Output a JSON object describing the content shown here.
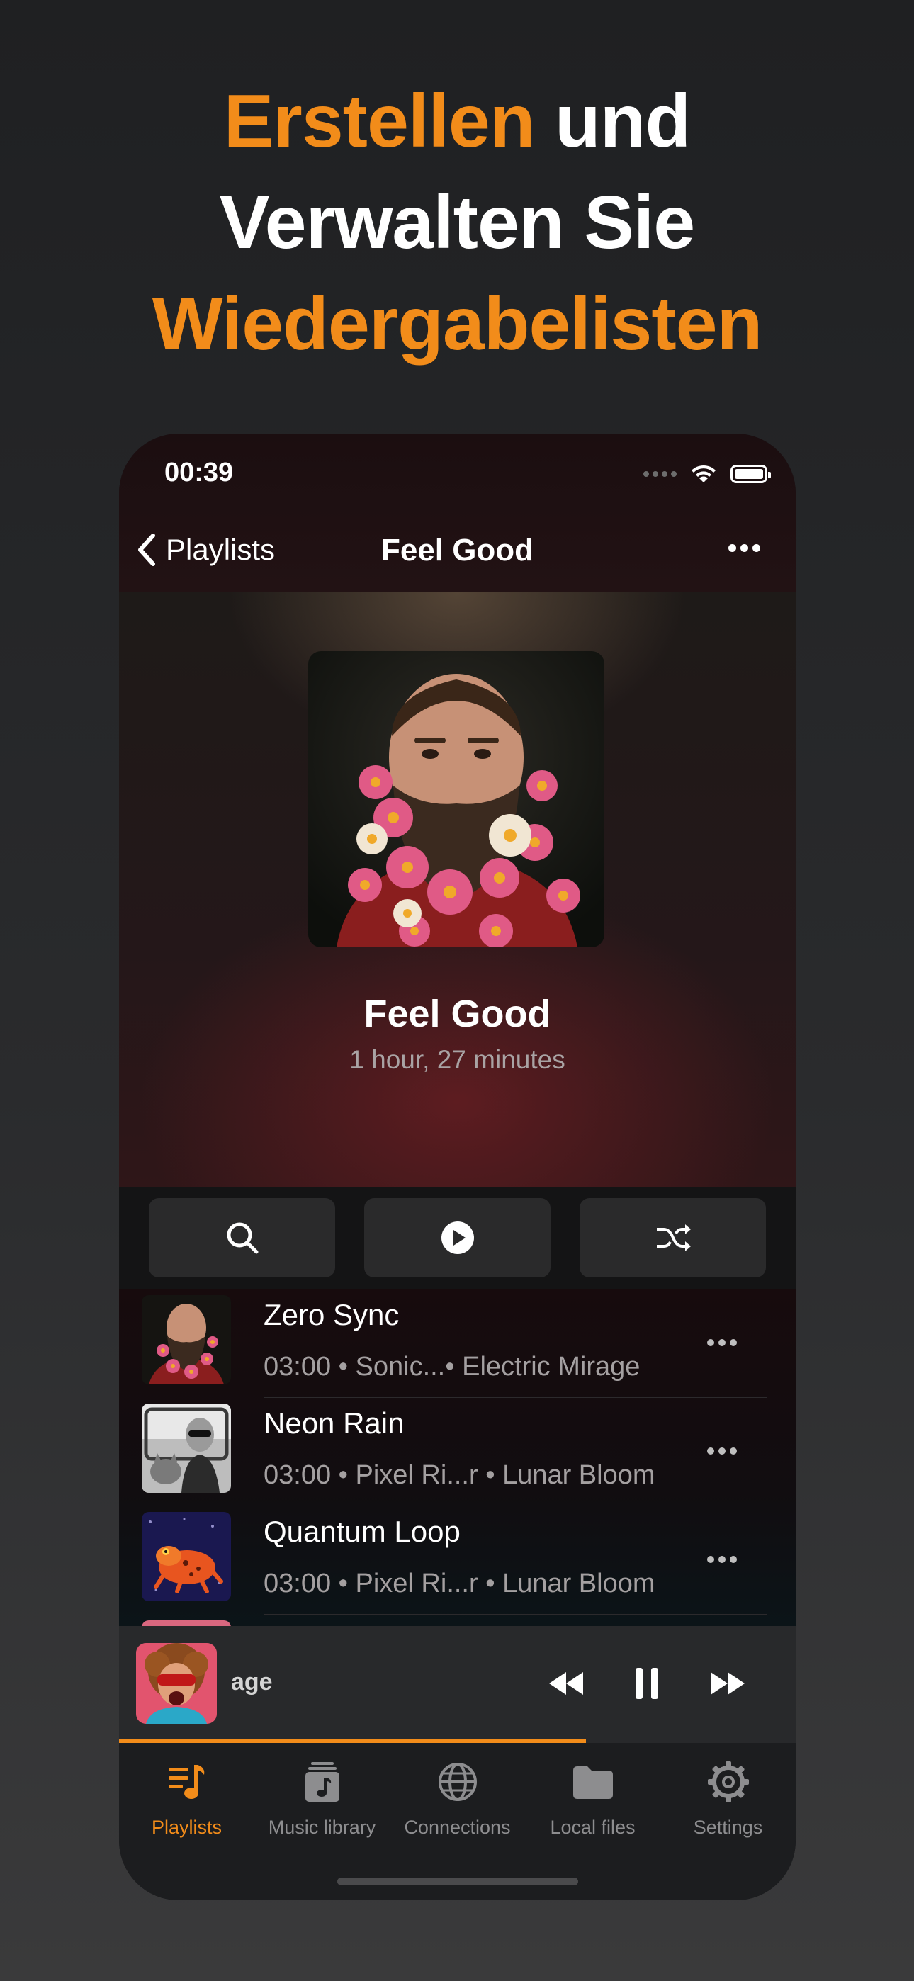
{
  "headline": {
    "line1_orange": "Erstellen",
    "line1_white": " und",
    "line2": "Verwalten Sie",
    "line3": "Wiedergabelisten"
  },
  "status_bar": {
    "time": "00:39"
  },
  "nav": {
    "back_label": "Playlists",
    "title": "Feel Good"
  },
  "playlist": {
    "title": "Feel Good",
    "duration": "1 hour, 27 minutes"
  },
  "tracks": [
    {
      "title": "Zero Sync",
      "meta": "03:00 • Sonic...• Electric Mirage"
    },
    {
      "title": "Neon Rain",
      "meta": "03:00 • Pixel Ri...r • Lunar Bloom"
    },
    {
      "title": "Quantum Loop",
      "meta": "03:00 • Pixel Ri...r • Lunar Bloom"
    }
  ],
  "mini_player": {
    "title": "age",
    "progress": 0.69
  },
  "tabs": [
    {
      "label": "Playlists",
      "icon": "playlists-icon",
      "active": true
    },
    {
      "label": "Music library",
      "icon": "music-library-icon",
      "active": false
    },
    {
      "label": "Connections",
      "icon": "globe-icon",
      "active": false
    },
    {
      "label": "Local files",
      "icon": "folder-icon",
      "active": false
    },
    {
      "label": "Settings",
      "icon": "gear-icon",
      "active": false
    }
  ],
  "colors": {
    "accent": "#f28c1a",
    "background": "#1f2022"
  }
}
